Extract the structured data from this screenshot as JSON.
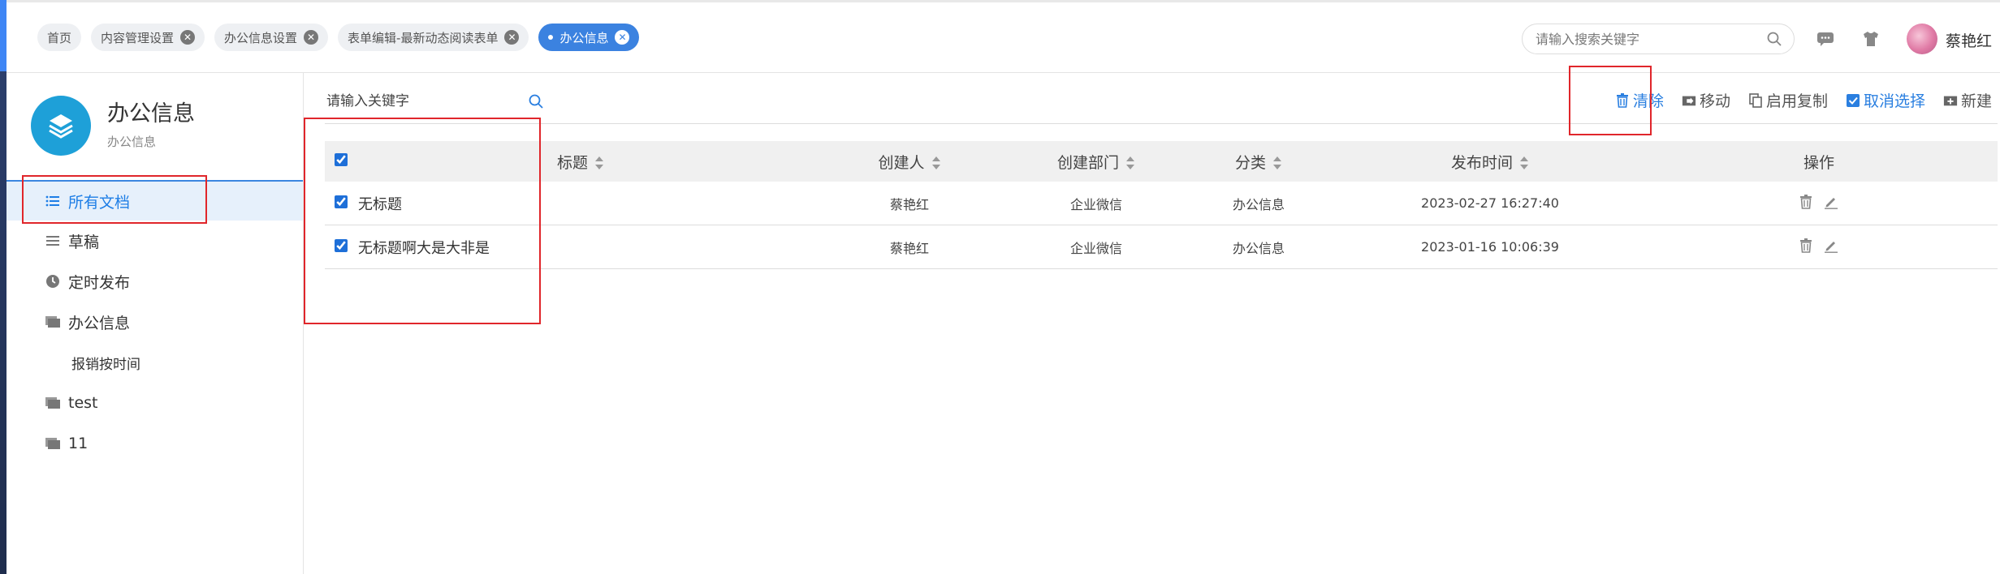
{
  "header": {
    "tabs": [
      {
        "label": "首页",
        "closable": false,
        "active": false
      },
      {
        "label": "内容管理设置",
        "closable": true,
        "active": false
      },
      {
        "label": "办公信息设置",
        "closable": true,
        "active": false
      },
      {
        "label": "表单编辑-最新动态阅读表单",
        "closable": true,
        "active": false
      },
      {
        "label": "办公信息",
        "closable": true,
        "active": true
      }
    ],
    "search_placeholder": "请输入搜索关键字",
    "username": "蔡艳红"
  },
  "sidebar": {
    "title": "办公信息",
    "subtitle": "办公信息",
    "items": [
      {
        "label": "所有文档",
        "icon": "list-icon",
        "active": true
      },
      {
        "label": "草稿",
        "icon": "menu-icon"
      },
      {
        "label": "定时发布",
        "icon": "clock-icon"
      },
      {
        "label": "办公信息",
        "icon": "folder-icon"
      },
      {
        "label": "报销按时间",
        "icon": "",
        "sub": true
      },
      {
        "label": "test",
        "icon": "folder-icon"
      },
      {
        "label": "11",
        "icon": "folder-icon"
      }
    ]
  },
  "main": {
    "search_placeholder": "请输入关键字",
    "toolbar": {
      "clear": "清除",
      "move": "移动",
      "enable_copy": "启用复制",
      "cancel_select": "取消选择",
      "new": "新建"
    },
    "columns": {
      "title": "标题",
      "creator": "创建人",
      "dept": "创建部门",
      "category": "分类",
      "publish_time": "发布时间",
      "ops": "操作"
    },
    "rows": [
      {
        "title": "无标题",
        "creator": "蔡艳红",
        "dept": "企业微信",
        "category": "办公信息",
        "time": "2023-02-27 16:27:40",
        "checked": true
      },
      {
        "title": "无标题啊大是大非是",
        "creator": "蔡艳红",
        "dept": "企业微信",
        "category": "办公信息",
        "time": "2023-01-16 10:06:39",
        "checked": true
      }
    ]
  },
  "colors": {
    "accent": "#3b82e0",
    "highlight": "#e0262b",
    "logo": "#1ea0d8"
  }
}
